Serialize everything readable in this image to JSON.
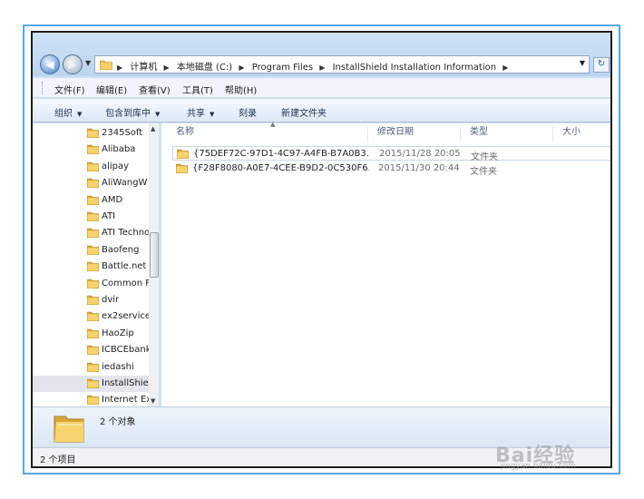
{
  "address_bar": {
    "crumbs": [
      "计算机",
      "本地磁盘 (C:)",
      "Program Files",
      "InstallShield Installation Information"
    ]
  },
  "menu": [
    "文件(F)",
    "编辑(E)",
    "查看(V)",
    "工具(T)",
    "帮助(H)"
  ],
  "toolbar": {
    "organize": "组织",
    "include_in_library": "包含到库中",
    "share": "共享",
    "burn": "刻录",
    "new_folder": "新建文件夹"
  },
  "nav_pane": {
    "items": [
      {
        "label": "2345Soft"
      },
      {
        "label": "Alibaba"
      },
      {
        "label": "alipay"
      },
      {
        "label": "AliWangW"
      },
      {
        "label": "AMD"
      },
      {
        "label": "ATI"
      },
      {
        "label": "ATI Techno"
      },
      {
        "label": "Baofeng"
      },
      {
        "label": "Battle.net"
      },
      {
        "label": "Common F"
      },
      {
        "label": "dvir"
      },
      {
        "label": "ex2service"
      },
      {
        "label": "HaoZip"
      },
      {
        "label": "ICBCEbank"
      },
      {
        "label": "iedashi"
      },
      {
        "label": "InstallShie"
      },
      {
        "label": "Internet Ex"
      }
    ],
    "selected_index": 15
  },
  "file_list": {
    "columns": [
      "名称",
      "修改日期",
      "类型",
      "大小"
    ],
    "rows": [
      {
        "name": "{75DEF72C-97D1-4C97-A4FB-B7A0B3...",
        "date": "2015/11/28 20:05",
        "type": "文件夹"
      },
      {
        "name": "{F28F8080-A0E7-4CEE-B9D2-0C530F6...",
        "date": "2015/11/30 20:44",
        "type": "文件夹"
      }
    ]
  },
  "details": {
    "count_text": "2 个对象"
  },
  "status_bar": {
    "text": "2 个项目"
  },
  "watermark": {
    "brand": "Bai经验",
    "url": "jingyan.baidu.com"
  }
}
